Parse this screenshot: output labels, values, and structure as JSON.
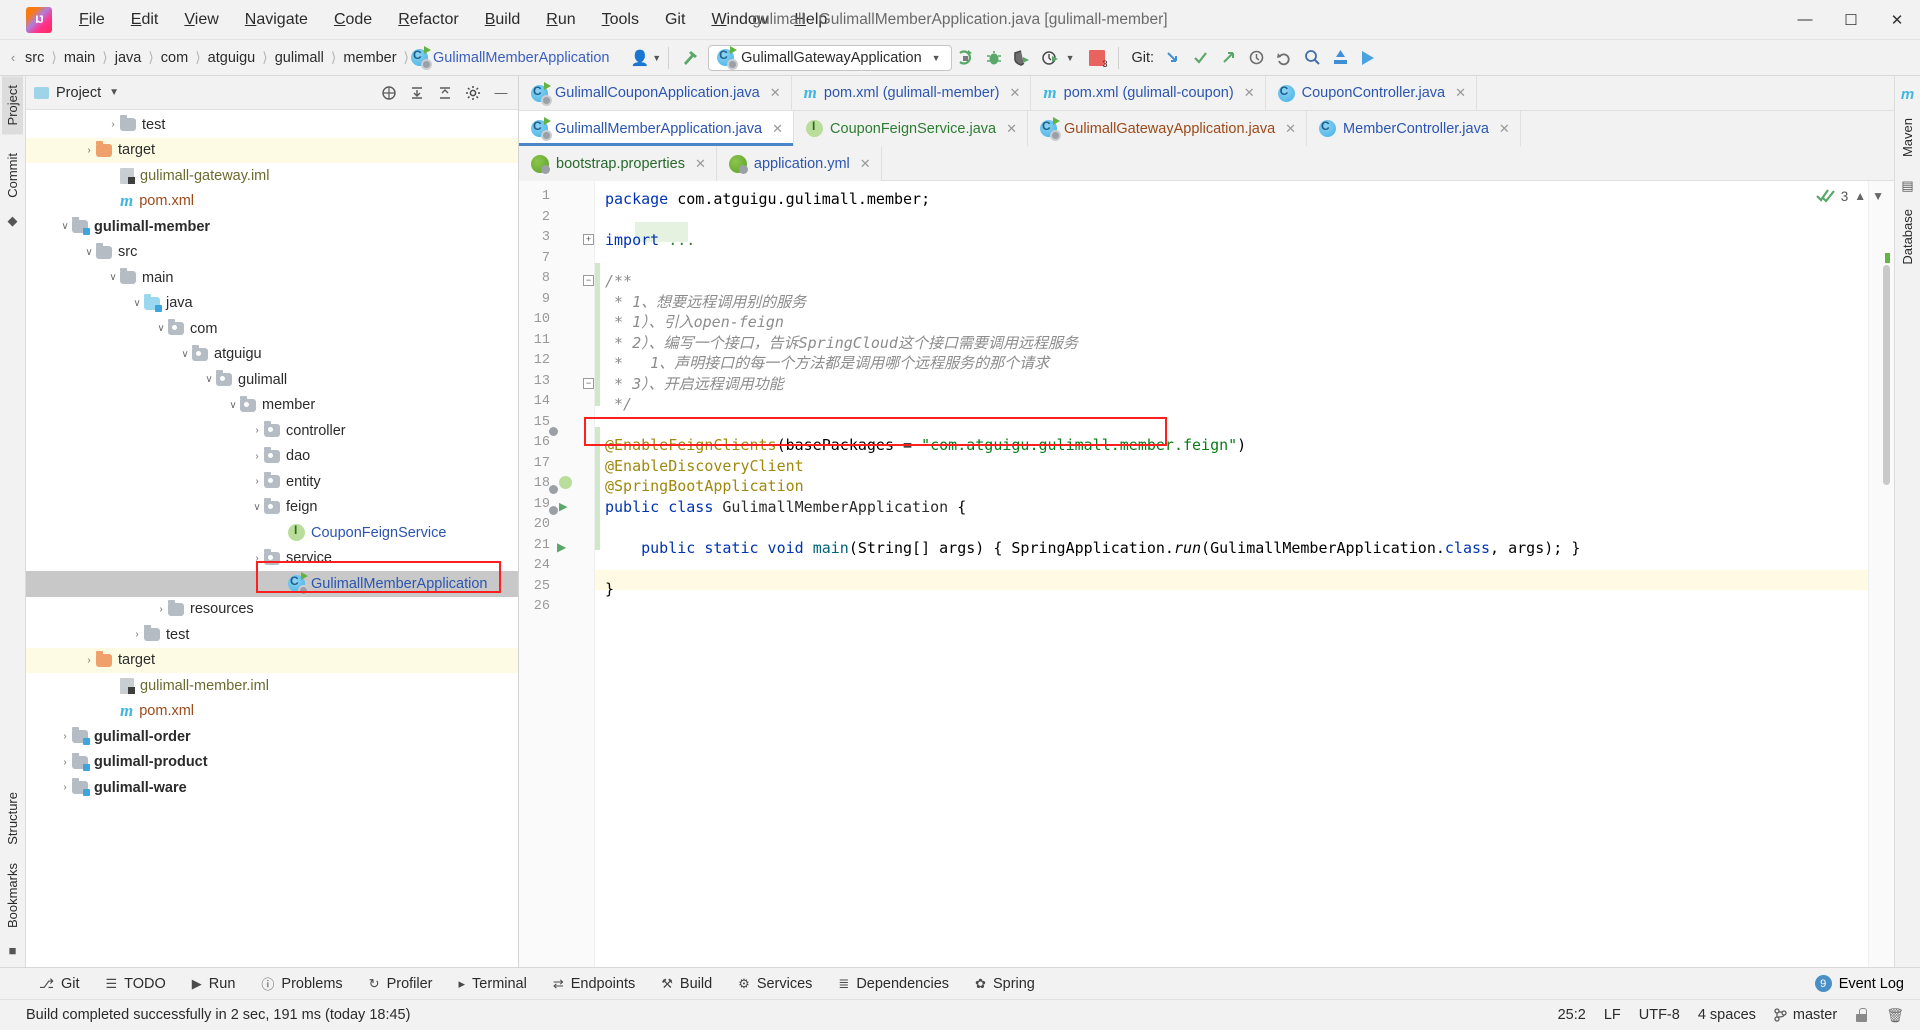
{
  "window": {
    "title": "gulimall - GulimallMemberApplication.java [gulimall-member]",
    "minimize": "—",
    "maximize": "❐",
    "close": "✕"
  },
  "menubar": {
    "items": [
      {
        "label": "File"
      },
      {
        "label": "Edit"
      },
      {
        "label": "View"
      },
      {
        "label": "Navigate"
      },
      {
        "label": "Code"
      },
      {
        "label": "Refactor"
      },
      {
        "label": "Build"
      },
      {
        "label": "Run"
      },
      {
        "label": "Tools"
      },
      {
        "label": "Git"
      },
      {
        "label": "Window"
      },
      {
        "label": "Help"
      }
    ]
  },
  "navbar": {
    "crumbs": [
      "src",
      "main",
      "java",
      "com",
      "atguigu",
      "gulimall",
      "member"
    ],
    "current_file": "GulimallMemberApplication",
    "run_config": "GulimallGatewayApplication",
    "git_label": "Git:",
    "error_badge": "3"
  },
  "project_panel": {
    "title": "Project",
    "tree": [
      {
        "indent": 3,
        "arrow": "›",
        "icon": "folder",
        "label": "test",
        "style": "normal"
      },
      {
        "indent": 2,
        "arrow": "›",
        "icon": "folder-orange",
        "label": "target",
        "style": "yellow"
      },
      {
        "indent": 3,
        "arrow": "",
        "icon": "iml",
        "label": "gulimall-gateway.iml",
        "style": "iml"
      },
      {
        "indent": 3,
        "arrow": "",
        "icon": "maven",
        "label": "pom.xml",
        "style": "pom"
      },
      {
        "indent": 1,
        "arrow": "∨",
        "icon": "module",
        "label": "gulimall-member",
        "style": "bold"
      },
      {
        "indent": 2,
        "arrow": "∨",
        "icon": "folder",
        "label": "src",
        "style": "normal"
      },
      {
        "indent": 3,
        "arrow": "∨",
        "icon": "folder",
        "label": "main",
        "style": "normal"
      },
      {
        "indent": 4,
        "arrow": "∨",
        "icon": "folder-blue",
        "label": "java",
        "style": "normal"
      },
      {
        "indent": 5,
        "arrow": "∨",
        "icon": "package",
        "label": "com",
        "style": "normal"
      },
      {
        "indent": 6,
        "arrow": "∨",
        "icon": "package",
        "label": "atguigu",
        "style": "normal"
      },
      {
        "indent": 7,
        "arrow": "∨",
        "icon": "package",
        "label": "gulimall",
        "style": "normal"
      },
      {
        "indent": 8,
        "arrow": "∨",
        "icon": "package",
        "label": "member",
        "style": "normal"
      },
      {
        "indent": 9,
        "arrow": "›",
        "icon": "package",
        "label": "controller",
        "style": "normal"
      },
      {
        "indent": 9,
        "arrow": "›",
        "icon": "package",
        "label": "dao",
        "style": "normal"
      },
      {
        "indent": 9,
        "arrow": "›",
        "icon": "package",
        "label": "entity",
        "style": "normal"
      },
      {
        "indent": 9,
        "arrow": "∨",
        "icon": "package",
        "label": "feign",
        "style": "normal"
      },
      {
        "indent": 10,
        "arrow": "",
        "icon": "interface",
        "label": "CouponFeignService",
        "style": "java"
      },
      {
        "indent": 9,
        "arrow": "›",
        "icon": "package",
        "label": "service",
        "style": "normal"
      },
      {
        "indent": 10,
        "arrow": "",
        "icon": "springclass",
        "label": "GulimallMemberApplication",
        "style": "selected-java"
      },
      {
        "indent": 5,
        "arrow": "›",
        "icon": "folder",
        "label": "resources",
        "style": "normal"
      },
      {
        "indent": 4,
        "arrow": "›",
        "icon": "folder",
        "label": "test",
        "style": "normal"
      },
      {
        "indent": 2,
        "arrow": "›",
        "icon": "folder-orange",
        "label": "target",
        "style": "yellow"
      },
      {
        "indent": 3,
        "arrow": "",
        "icon": "iml",
        "label": "gulimall-member.iml",
        "style": "iml"
      },
      {
        "indent": 3,
        "arrow": "",
        "icon": "maven",
        "label": "pom.xml",
        "style": "pom"
      },
      {
        "indent": 1,
        "arrow": "›",
        "icon": "module",
        "label": "gulimall-order",
        "style": "bold"
      },
      {
        "indent": 1,
        "arrow": "›",
        "icon": "module",
        "label": "gulimall-product",
        "style": "bold"
      },
      {
        "indent": 1,
        "arrow": "›",
        "icon": "module",
        "label": "gulimall-ware",
        "style": "bold"
      }
    ]
  },
  "left_rail": {
    "tabs": [
      "Project",
      "Commit",
      "Structure",
      "Bookmarks"
    ]
  },
  "right_rail": {
    "tabs": [
      "m",
      "Maven",
      "Database"
    ]
  },
  "editor": {
    "tab_rows": [
      [
        {
          "label": "GulimallCouponApplication.java",
          "icon": "springclass",
          "color": "blue",
          "active": false
        },
        {
          "label": "pom.xml (gulimall-member)",
          "icon": "maven",
          "color": "blue",
          "active": false
        },
        {
          "label": "pom.xml (gulimall-coupon)",
          "icon": "maven",
          "color": "blue",
          "active": false
        },
        {
          "label": "CouponController.java",
          "icon": "class",
          "color": "blue",
          "active": false
        }
      ],
      [
        {
          "label": "GulimallMemberApplication.java",
          "icon": "springclass",
          "color": "blue",
          "active": true
        },
        {
          "label": "CouponFeignService.java",
          "icon": "interface",
          "color": "green",
          "active": false
        },
        {
          "label": "GulimallGatewayApplication.java",
          "icon": "springclass",
          "color": "brown",
          "active": false
        },
        {
          "label": "MemberController.java",
          "icon": "class",
          "color": "blue",
          "active": false
        }
      ],
      [
        {
          "label": "bootstrap.properties",
          "icon": "spring",
          "color": "darkgreen",
          "active": false
        },
        {
          "label": "application.yml",
          "icon": "spring",
          "color": "blue",
          "active": false
        }
      ]
    ],
    "inspection_count": "3",
    "line_numbers": [
      "1",
      "2",
      "3",
      "7",
      "8",
      "9",
      "10",
      "11",
      "12",
      "13",
      "14",
      "15",
      "16",
      "17",
      "18",
      "19",
      "20",
      "21",
      "24",
      "25",
      "26"
    ],
    "code_lines": [
      {
        "n": "1",
        "text": "package com.atguigu.gulimall.member;",
        "kind": "package"
      },
      {
        "n": "2",
        "text": "",
        "kind": "blank"
      },
      {
        "n": "3",
        "text": "import ...",
        "kind": "import"
      },
      {
        "n": "7",
        "text": "",
        "kind": "blank"
      },
      {
        "n": "8",
        "text": "/**",
        "kind": "comment"
      },
      {
        "n": "9",
        "text": " * 1、想要远程调用别的服务",
        "kind": "comment"
      },
      {
        "n": "10",
        "text": " * 1）、引入open-feign",
        "kind": "comment"
      },
      {
        "n": "11",
        "text": " * 2）、编写一个接口，告诉SpringCloud这个接口需要调用远程服务",
        "kind": "comment"
      },
      {
        "n": "12",
        "text": " *   1、声明接口的每一个方法都是调用哪个远程服务的那个请求",
        "kind": "comment"
      },
      {
        "n": "13",
        "text": " * 3）、开启远程调用功能",
        "kind": "comment"
      },
      {
        "n": "14",
        "text": " */",
        "kind": "comment"
      },
      {
        "n": "15",
        "text": "",
        "kind": "blank"
      },
      {
        "n": "16",
        "text": "@EnableFeignClients(basePackages = \"com.atguigu.gulimall.member.feign\")",
        "kind": "annotation-highlighted"
      },
      {
        "n": "17",
        "text": "@EnableDiscoveryClient",
        "kind": "annotation"
      },
      {
        "n": "18",
        "text": "@SpringBootApplication",
        "kind": "annotation"
      },
      {
        "n": "19",
        "text": "public class GulimallMemberApplication {",
        "kind": "class-decl"
      },
      {
        "n": "20",
        "text": "",
        "kind": "blank"
      },
      {
        "n": "21",
        "text": "    public static void main(String[] args) { SpringApplication.run(GulimallMemberApplication.class, args); }",
        "kind": "method"
      },
      {
        "n": "24",
        "text": "",
        "kind": "blank"
      },
      {
        "n": "25",
        "text": "}",
        "kind": "close"
      },
      {
        "n": "26",
        "text": "",
        "kind": "blank"
      }
    ]
  },
  "bottom_toolwindows": [
    {
      "label": "Git",
      "icon": "git-icon"
    },
    {
      "label": "TODO",
      "icon": "todo-icon"
    },
    {
      "label": "Run",
      "icon": "run-icon"
    },
    {
      "label": "Problems",
      "icon": "problems-icon"
    },
    {
      "label": "Profiler",
      "icon": "profiler-icon"
    },
    {
      "label": "Terminal",
      "icon": "terminal-icon"
    },
    {
      "label": "Endpoints",
      "icon": "endpoints-icon"
    },
    {
      "label": "Build",
      "icon": "build-icon"
    },
    {
      "label": "Services",
      "icon": "services-icon"
    },
    {
      "label": "Dependencies",
      "icon": "dependencies-icon"
    },
    {
      "label": "Spring",
      "icon": "spring-icon"
    }
  ],
  "event_log": {
    "label": "Event Log",
    "badge": "9"
  },
  "statusbar": {
    "message": "Build completed successfully in 2 sec, 191 ms (today 18:45)",
    "caret": "25:2",
    "line_sep": "LF",
    "encoding": "UTF-8",
    "indent": "4 spaces",
    "branch": "master"
  },
  "colors": {
    "accent": "#4a86c8",
    "annotation": "#9e880d",
    "string": "#067d17",
    "keyword": "#0033b3",
    "highlight_box": "#ff1f1f",
    "selection": "#c8c8c8"
  }
}
